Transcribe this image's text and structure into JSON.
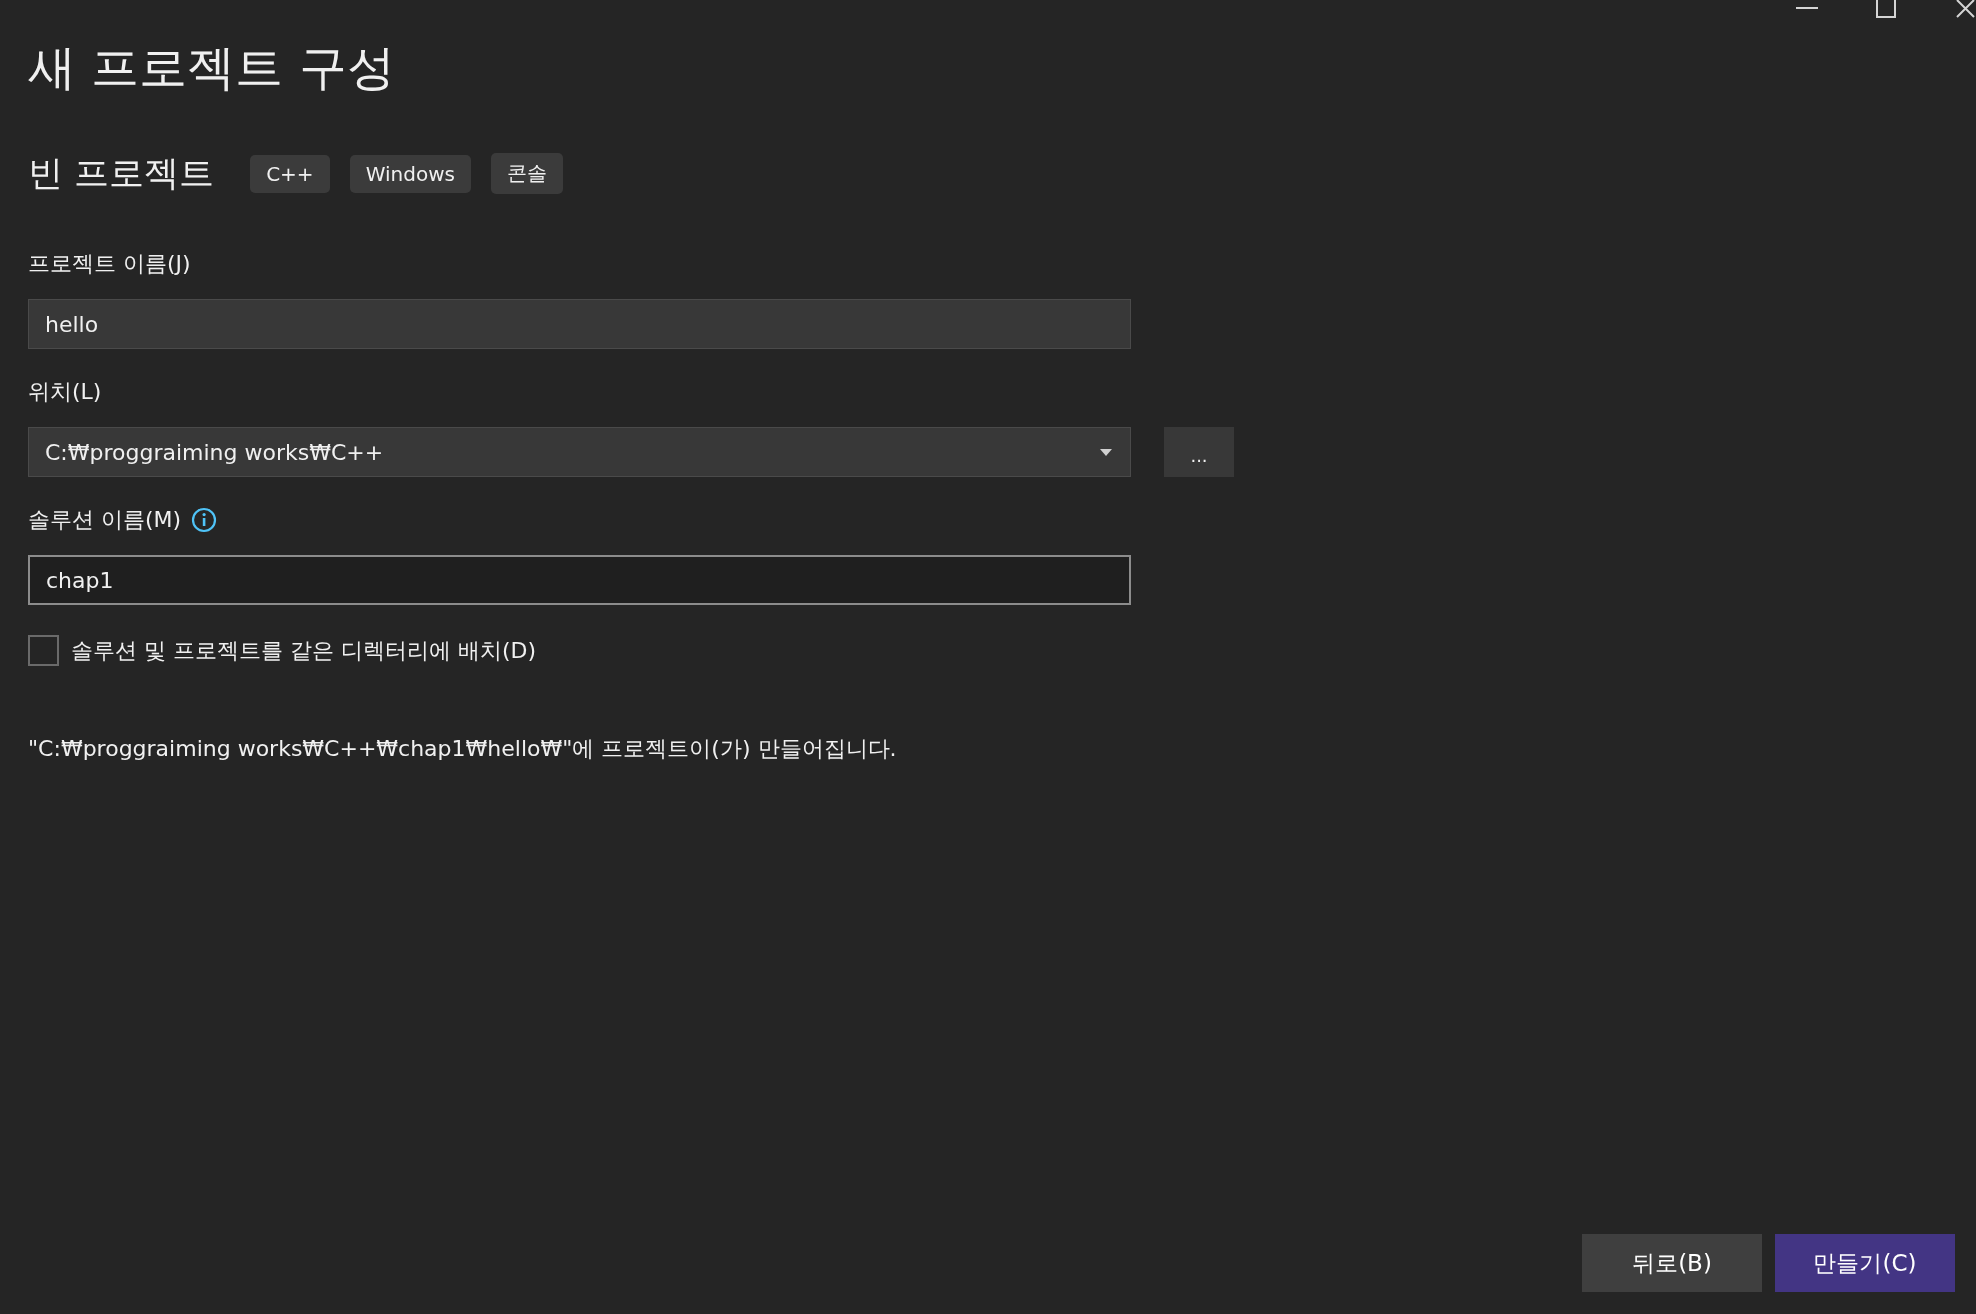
{
  "window": {
    "controls": [
      {
        "kind": "minimize"
      },
      {
        "kind": "maximize"
      },
      {
        "kind": "close"
      }
    ]
  },
  "title": "새 프로젝트 구성",
  "template": {
    "name": "빈 프로젝트",
    "tags": [
      "C++",
      "Windows",
      "콘솔"
    ]
  },
  "fields": [
    {
      "kind": "text",
      "label": "프로젝트 이름(J)",
      "value": "hello",
      "focused": false
    },
    {
      "kind": "dropdown",
      "label": "위치(L)",
      "value": "C:₩proggraiming works₩C++",
      "browse": "..."
    },
    {
      "kind": "text",
      "label": "솔루션 이름(M)",
      "value": "chap1",
      "focused": true,
      "info": true
    }
  ],
  "same_directory": {
    "label": "솔루션 및 프로젝트를 같은 디렉터리에 배치(D)",
    "checked": false
  },
  "result_path": "\"C:₩proggraiming works₩C++₩chap1₩hello₩\"에 프로젝트이(가) 만들어집니다.",
  "buttons": [
    {
      "label": "뒤로(B)",
      "kind": "secondary"
    },
    {
      "label": "만들기(C)",
      "kind": "primary"
    }
  ]
}
